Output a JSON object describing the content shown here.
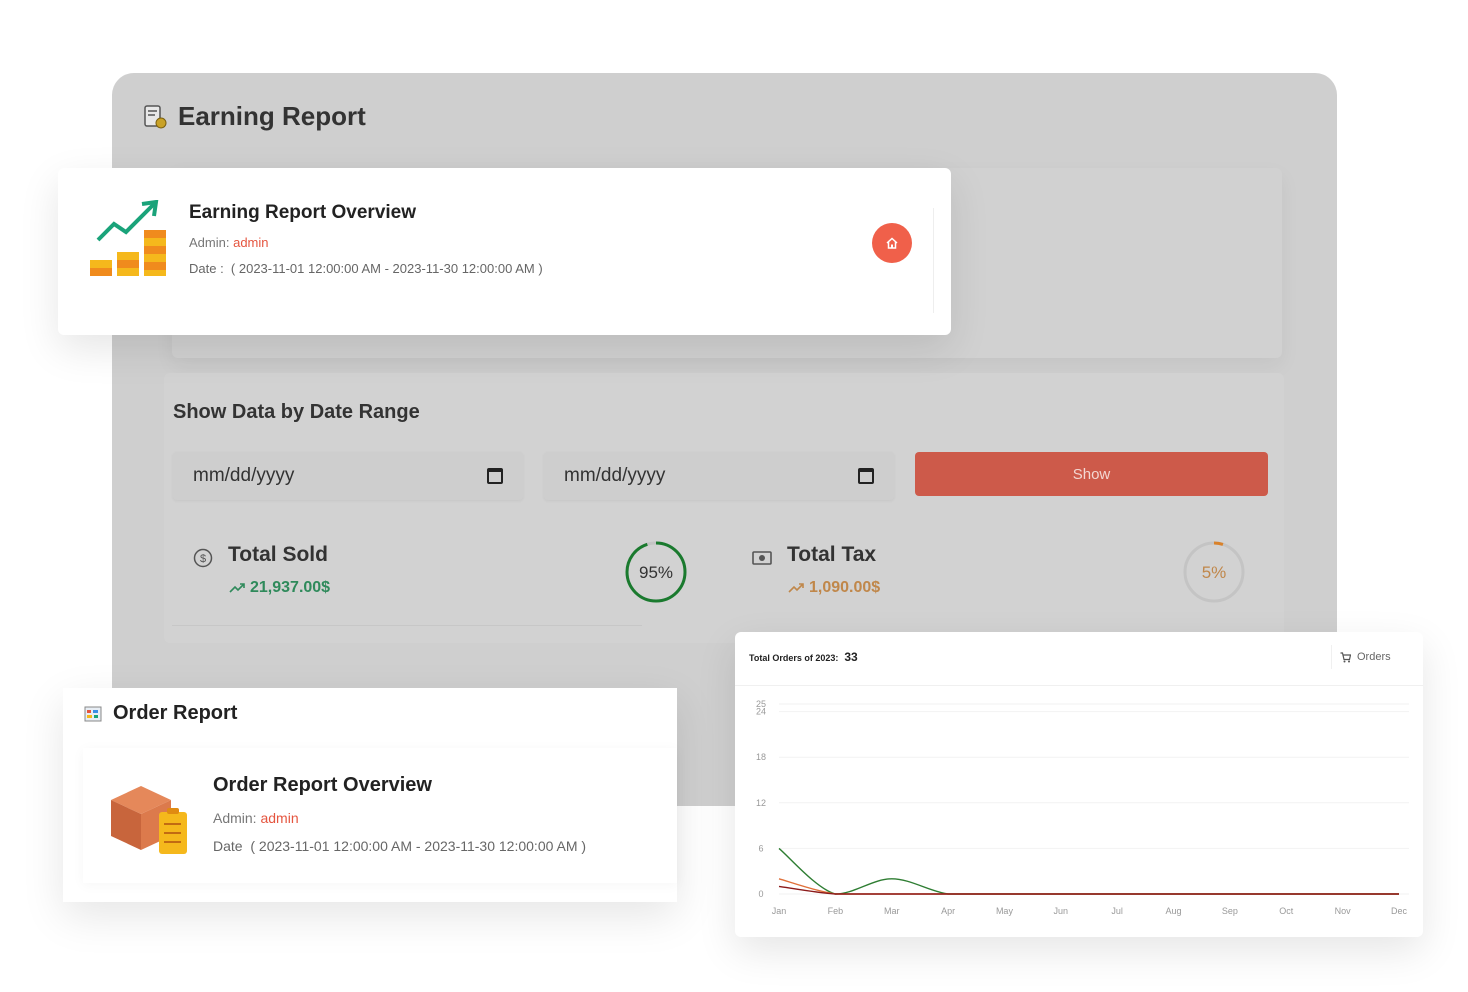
{
  "earning_report": {
    "page_title": "Earning Report",
    "overview_title": "Earning Report Overview",
    "admin_label": "Admin:",
    "admin_name": "admin",
    "date_label": "Date :",
    "date_range": "( 2023-11-01 12:00:00 AM - 2023-11-30 12:00:00 AM )"
  },
  "date_range": {
    "title": "Show Data by Date Range",
    "from_placeholder": "mm/dd/yyyy",
    "to_placeholder": "mm/dd/yyyy",
    "show_label": "Show"
  },
  "stats": {
    "total_sold": {
      "label": "Total Sold",
      "value": "21,937.00$",
      "percent_label": "95%",
      "percent": 95,
      "color": "#1e8e3e"
    },
    "total_tax": {
      "label": "Total Tax",
      "value": "1,090.00$",
      "percent_label": "5%",
      "percent": 5,
      "color": "#d9822b"
    }
  },
  "order_report": {
    "page_title": "Order Report",
    "overview_title": "Order Report Overview",
    "admin_label": "Admin:",
    "admin_name": "admin",
    "date_label": "Date",
    "date_range": "( 2023-11-01 12:00:00 AM - 2023-11-30 12:00:00 AM )"
  },
  "orders_chart": {
    "header_label": "Total Orders of 2023:",
    "total": "33",
    "orders_button": "Orders"
  },
  "chart_data": {
    "type": "line",
    "categories": [
      "Jan",
      "Feb",
      "Mar",
      "Apr",
      "May",
      "Jun",
      "Jul",
      "Aug",
      "Sep",
      "Oct",
      "Nov",
      "Dec"
    ],
    "yticks": [
      "0",
      "6",
      "12",
      "18",
      "24",
      "25"
    ],
    "ylim": [
      0,
      25
    ],
    "series": [
      {
        "values": [
          6,
          0,
          2,
          0,
          0,
          0,
          0,
          0,
          0,
          0,
          0,
          0
        ],
        "color": "#2e7d32"
      },
      {
        "values": [
          2,
          0,
          0,
          0,
          0,
          0,
          0,
          0,
          0,
          0,
          0,
          0
        ],
        "color": "#e0703a"
      },
      {
        "values": [
          1,
          0,
          0,
          0,
          0,
          0,
          0,
          0,
          0,
          0,
          0,
          0
        ],
        "color": "#8b1a1a"
      }
    ]
  }
}
